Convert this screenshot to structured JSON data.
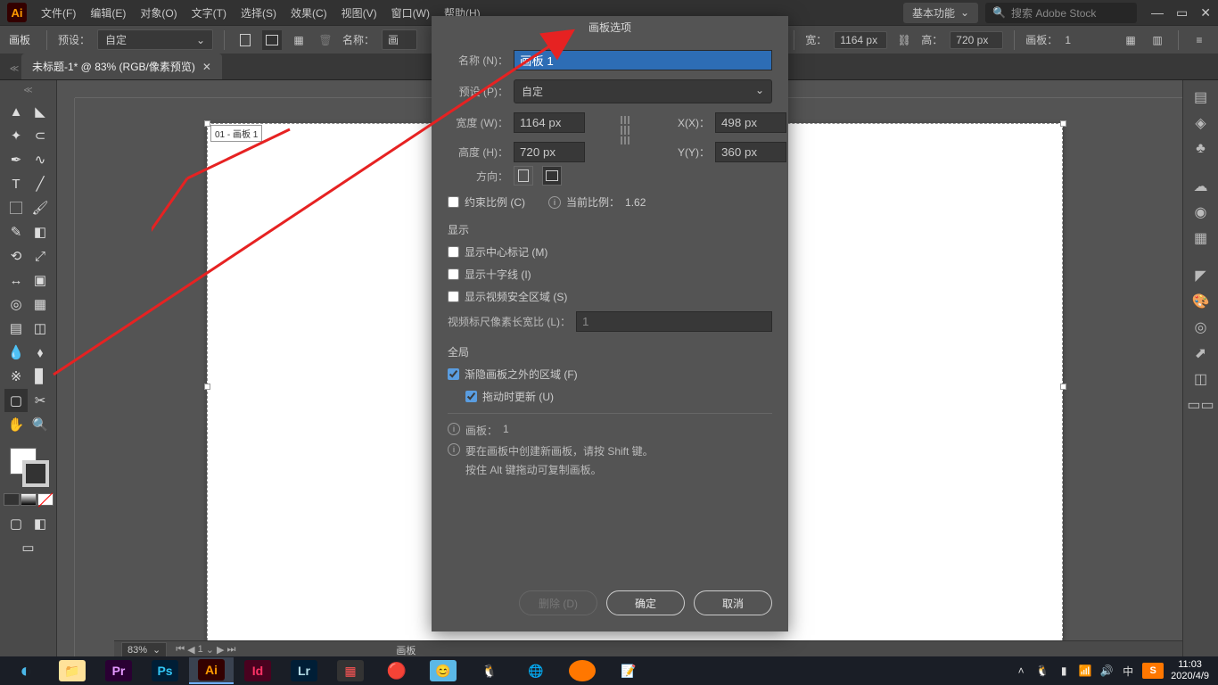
{
  "app": {
    "logo": "Ai"
  },
  "menu": {
    "file": "文件(F)",
    "edit": "编辑(E)",
    "object": "对象(O)",
    "text": "文字(T)",
    "select": "选择(S)",
    "effect": "效果(C)",
    "view": "视图(V)",
    "window": "窗口(W)",
    "help": "帮助(H)"
  },
  "top_right": {
    "workspace": "基本功能",
    "search_placeholder": "搜索 Adobe Stock"
  },
  "control": {
    "artboard_label": "画板",
    "preset_label": "预设：",
    "preset_value": "自定",
    "name_label": "名称：",
    "width_label": "宽：",
    "width_val": "1164 px",
    "height_label": "高：",
    "height_val": "720 px",
    "artboard_info_label": "画板：",
    "artboard_info": "1"
  },
  "doc_tab": {
    "title": "未标题-1* @ 83% (RGB/像素预览)"
  },
  "artboard": {
    "label": "01 - 画板 1"
  },
  "status": {
    "zoom": "83%",
    "current": "1",
    "tool": "画板"
  },
  "dialog": {
    "title": "画板选项",
    "name_label": "名称 (N)：",
    "name_val": "画板 1",
    "preset_label": "预设 (P)：",
    "preset_val": "自定",
    "width_label": "宽度 (W)：",
    "width_val": "1164 px",
    "height_label": "高度 (H)：",
    "height_val": "720 px",
    "x_label": "X(X)：",
    "x_val": "498 px",
    "y_label": "Y(Y)：",
    "y_val": "360 px",
    "orient_label": "方向：",
    "constrain_label": "约束比例 (C)",
    "curr_ratio_label": "当前比例：",
    "curr_ratio": "1.62",
    "display_section": "显示",
    "show_center": "显示中心标记 (M)",
    "show_cross": "显示十字线 (I)",
    "show_video": "显示视频安全区域 (S)",
    "video_ratio_label": "视频标尺像素长宽比 (L)：",
    "video_ratio": "1",
    "global_section": "全局",
    "fade_out": "渐隐画板之外的区域 (F)",
    "update_drag": "拖动时更新 (U)",
    "artboard_count_label": "画板：",
    "artboard_count": "1",
    "tip1": "要在画板中创建新画板，请按 Shift 键。",
    "tip2": "按住 Alt 键拖动可复制画板。",
    "delete_btn": "删除 (D)",
    "ok_btn": "确定",
    "cancel_btn": "取消"
  },
  "taskbar": {
    "time": "11:03",
    "date": "2020/4/9",
    "ime": "中",
    "sogou": "S"
  }
}
